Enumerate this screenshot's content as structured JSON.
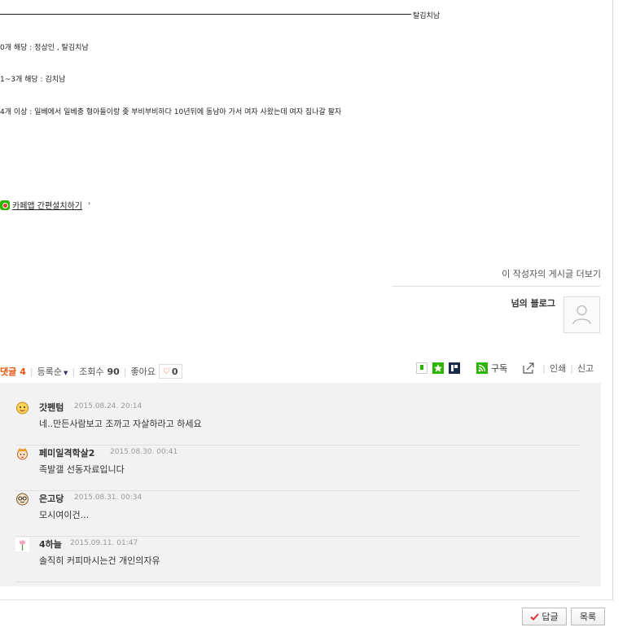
{
  "post": {
    "rule_label": "탈김치남",
    "lines": [
      "0개 해당 : 정상인 , 탈김치남",
      "1~3개 해당 : 김치남",
      "4개 이상 :  일베에서 일베충 형아들이랑 좆 부비부비하다 10년뒤에 동남아 가서 여자 사왔는데 여자 집나갈 팔자"
    ]
  },
  "cafe_app": {
    "link_label": "카페앱 간편설치하기",
    "arrow": "›"
  },
  "author": {
    "more_posts_label": "이 작성자의 게시글 더보기",
    "blog_name": "넘의 블로그"
  },
  "stats": {
    "comments_label": "댓글",
    "comments_count": "4",
    "sort_label": "등록순",
    "views_label": "조회수",
    "views_count": "90",
    "likes_label": "좋아요",
    "likes_count": "0"
  },
  "tools": {
    "subscribe_label": "구독",
    "print_label": "인쇄",
    "report_label": "신고"
  },
  "comments": [
    {
      "nickname": "갓펜텀",
      "date": "2015.08.24. 20:14",
      "body": "네..만든사람보고 조까고 자살하라고 하세요"
    },
    {
      "nickname": "페미일격학살2",
      "date": "2015.08.30. 00:41",
      "body": "족발갤 선동자료입니다"
    },
    {
      "nickname": "은고당",
      "date": "2015.08.31. 00:34",
      "body": "모시여이건..."
    },
    {
      "nickname": "4하늘",
      "date": "2015.09.11. 01:47",
      "body": "솔직히 커피마시는건 개인의자유"
    }
  ],
  "buttons": {
    "reply_label": "답글",
    "list_label": "목록"
  },
  "colors": {
    "accent_red": "#e8540a",
    "cafe_green": "#2db400",
    "comment_bg": "#f2f2f2"
  }
}
